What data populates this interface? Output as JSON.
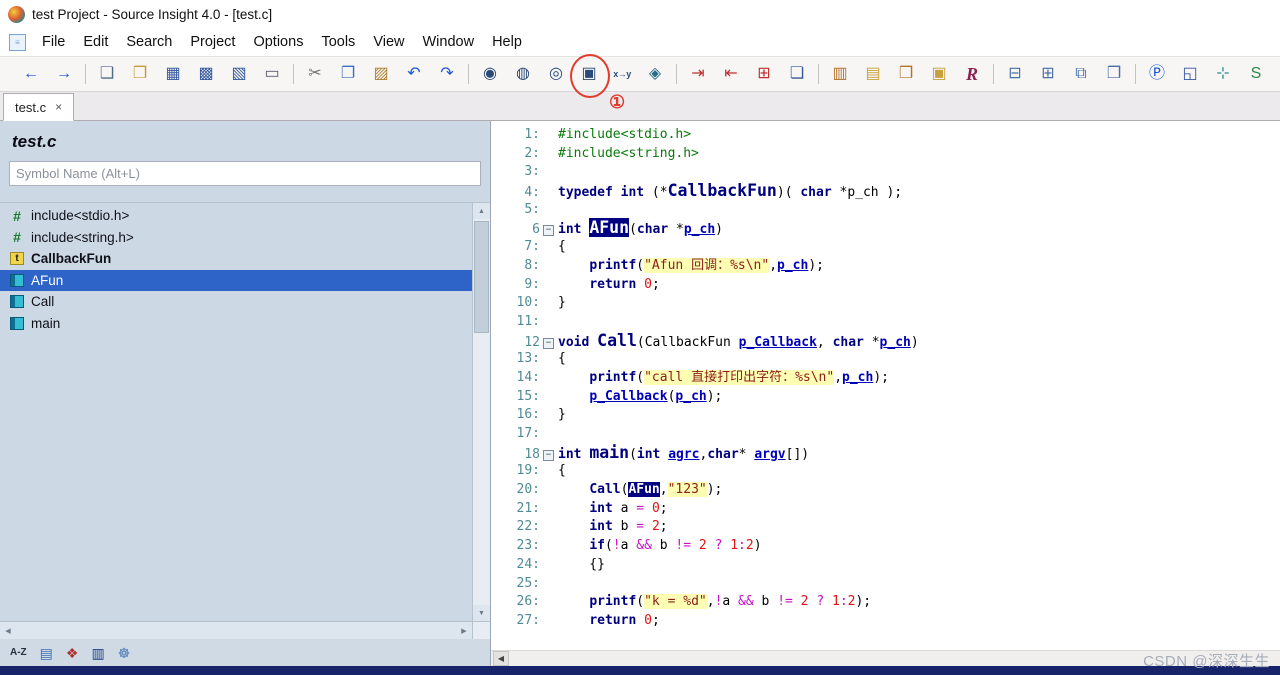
{
  "window": {
    "title": "test Project - Source Insight 4.0 - [test.c]"
  },
  "menu": {
    "items": [
      "File",
      "Edit",
      "Search",
      "Project",
      "Options",
      "Tools",
      "View",
      "Window",
      "Help"
    ]
  },
  "annotation": {
    "number": "①"
  },
  "toolbar": {
    "groups": [
      [
        {
          "name": "nav-back-icon",
          "g": "←",
          "c": "#1a56d6"
        },
        {
          "name": "nav-forward-icon",
          "g": "→",
          "c": "#1a56d6"
        }
      ],
      [
        {
          "name": "new-file-icon",
          "g": "❑",
          "c": "#55688a"
        },
        {
          "name": "open-file-icon",
          "g": "❒",
          "c": "#c79c3c"
        },
        {
          "name": "save-icon",
          "g": "▦",
          "c": "#35589e"
        },
        {
          "name": "save-all-icon",
          "g": "▩",
          "c": "#35589e"
        },
        {
          "name": "save-as-icon",
          "g": "▧",
          "c": "#35589e"
        },
        {
          "name": "print-icon",
          "g": "▭",
          "c": "#5a5a6e"
        }
      ],
      [
        {
          "name": "cut-icon",
          "g": "✂",
          "c": "#707070"
        },
        {
          "name": "copy-icon",
          "g": "❐",
          "c": "#3b6fc0"
        },
        {
          "name": "paste-icon",
          "g": "▨",
          "c": "#b08030"
        },
        {
          "name": "undo-icon",
          "g": "↶",
          "c": "#1a56d6"
        },
        {
          "name": "redo-icon",
          "g": "↷",
          "c": "#1a56d6"
        }
      ],
      [
        {
          "name": "search-icon",
          "g": "◉",
          "c": "#2a4a7a"
        },
        {
          "name": "search-forward-icon",
          "g": "◍",
          "c": "#2a4a7a"
        },
        {
          "name": "search-references-icon",
          "g": "◎",
          "c": "#2a4a7a"
        },
        {
          "name": "search-files-icon",
          "g": "▣",
          "c": "#2a4a7a",
          "circled": true
        },
        {
          "name": "replace-icon",
          "g": "x→y",
          "c": "#2a4a7a",
          "small": true
        },
        {
          "name": "search-project-icon",
          "g": "◈",
          "c": "#2a6a8a"
        }
      ],
      [
        {
          "name": "jump-to-definition-icon",
          "g": "⇥",
          "c": "#c03030"
        },
        {
          "name": "jump-to-caller-icon",
          "g": "⇤",
          "c": "#c03030"
        },
        {
          "name": "toggle-bookmark-icon",
          "g": "⊞",
          "c": "#c03030"
        },
        {
          "name": "go-back-reference-icon",
          "g": "❏",
          "c": "#35589e"
        }
      ],
      [
        {
          "name": "symbol-window-icon",
          "g": "▥",
          "c": "#b5722a"
        },
        {
          "name": "project-window-icon",
          "g": "▤",
          "c": "#caa03c"
        },
        {
          "name": "relation-window-icon",
          "g": "❒",
          "c": "#b5722a"
        },
        {
          "name": "context-window-icon",
          "g": "▣",
          "c": "#caa03c"
        },
        {
          "name": "references-icon",
          "g": "R",
          "c": "#8b2252",
          "fancy": true
        }
      ],
      [
        {
          "name": "tile-horizontal-icon",
          "g": "⊟",
          "c": "#4a6fa5"
        },
        {
          "name": "tile-vertical-icon",
          "g": "⊞",
          "c": "#4a6fa5"
        },
        {
          "name": "cascade-windows-icon",
          "g": "⧉",
          "c": "#4a6fa5"
        },
        {
          "name": "full-window-icon",
          "g": "❒",
          "c": "#4a6fa5"
        }
      ],
      [
        {
          "name": "parse-source-icon",
          "g": "Ⓟ",
          "c": "#1a56d6"
        },
        {
          "name": "zoom-window-icon",
          "g": "◱",
          "c": "#35589e"
        },
        {
          "name": "expand-special-icon",
          "g": "⊹",
          "c": "#2a8a8a"
        },
        {
          "name": "style-properties-icon",
          "g": "S",
          "c": "#2a8a4a"
        },
        {
          "name": "clip-window-icon",
          "g": "❙",
          "c": "#35589e"
        }
      ]
    ]
  },
  "tabs": [
    {
      "label": "test.c",
      "close": "×"
    }
  ],
  "symbol_panel": {
    "title": "test.c",
    "search_placeholder": "Symbol Name (Alt+L)",
    "items": [
      {
        "label": "include<stdio.h>",
        "icon": "include"
      },
      {
        "label": "include<string.h>",
        "icon": "include"
      },
      {
        "label": "CallbackFun",
        "icon": "typedef",
        "bold": true
      },
      {
        "label": "AFun",
        "icon": "func",
        "selected": true
      },
      {
        "label": "Call",
        "icon": "func"
      },
      {
        "label": "main",
        "icon": "func"
      }
    ],
    "tools": [
      {
        "name": "sort-alpha-icon",
        "g": "A-Z",
        "c": "#24303c",
        "text": true
      },
      {
        "name": "list-view-icon",
        "g": "▤",
        "c": "#3a6fb0"
      },
      {
        "name": "symbol-filter-icon",
        "g": "❖",
        "c": "#b03030"
      },
      {
        "name": "book-icon",
        "g": "▥",
        "c": "#1a3a8a"
      },
      {
        "name": "gear-icon",
        "g": "☸",
        "c": "#4a7ab5"
      }
    ]
  },
  "scrollbar": {
    "up": "▲",
    "down": "▼",
    "left": "◀",
    "right": "▶"
  },
  "editor": {
    "fold_glyph": "−",
    "lines": [
      {
        "n": 1,
        "tokens": [
          {
            "t": "inc",
            "v": "#include<stdio.h>"
          }
        ]
      },
      {
        "n": 2,
        "tokens": [
          {
            "t": "inc",
            "v": "#include<string.h>"
          }
        ]
      },
      {
        "n": 3,
        "tokens": []
      },
      {
        "n": 4,
        "tokens": [
          {
            "t": "kw",
            "v": "typedef"
          },
          {
            "t": "p",
            "v": " "
          },
          {
            "t": "kw",
            "v": "int"
          },
          {
            "t": "p",
            "v": " (*"
          },
          {
            "t": "fn",
            "v": "CallbackFun"
          },
          {
            "t": "p",
            "v": ")( "
          },
          {
            "t": "kw",
            "v": "char"
          },
          {
            "t": "p",
            "v": " *p_ch );"
          }
        ]
      },
      {
        "n": 5,
        "tokens": []
      },
      {
        "n": 6,
        "fold": true,
        "tokens": [
          {
            "t": "kw",
            "v": "int"
          },
          {
            "t": "p",
            "v": " "
          },
          {
            "t": "fnsel",
            "v": "AFun"
          },
          {
            "t": "p",
            "v": "("
          },
          {
            "t": "kw",
            "v": "char"
          },
          {
            "t": "p",
            "v": " *"
          },
          {
            "t": "param",
            "v": "p_ch"
          },
          {
            "t": "p",
            "v": ")"
          }
        ]
      },
      {
        "n": 7,
        "tokens": [
          {
            "t": "p",
            "v": "{"
          }
        ]
      },
      {
        "n": 8,
        "tokens": [
          {
            "t": "p",
            "v": "    "
          },
          {
            "t": "kw",
            "v": "printf"
          },
          {
            "t": "p",
            "v": "("
          },
          {
            "t": "str",
            "v": "\"Afun 回调：%s\\n\""
          },
          {
            "t": "p",
            "v": ","
          },
          {
            "t": "param",
            "v": "p_ch"
          },
          {
            "t": "p",
            "v": ");"
          }
        ]
      },
      {
        "n": 9,
        "tokens": [
          {
            "t": "p",
            "v": "    "
          },
          {
            "t": "kw",
            "v": "return"
          },
          {
            "t": "p",
            "v": " "
          },
          {
            "t": "num",
            "v": "0"
          },
          {
            "t": "p",
            "v": ";"
          }
        ]
      },
      {
        "n": 10,
        "tokens": [
          {
            "t": "p",
            "v": "}"
          }
        ]
      },
      {
        "n": 11,
        "tokens": []
      },
      {
        "n": 12,
        "fold": true,
        "tokens": [
          {
            "t": "kw",
            "v": "void"
          },
          {
            "t": "p",
            "v": " "
          },
          {
            "t": "fn",
            "v": "Call"
          },
          {
            "t": "p",
            "v": "(CallbackFun "
          },
          {
            "t": "param",
            "v": "p_Callback"
          },
          {
            "t": "p",
            "v": ", "
          },
          {
            "t": "kw",
            "v": "char"
          },
          {
            "t": "p",
            "v": " *"
          },
          {
            "t": "param",
            "v": "p_ch"
          },
          {
            "t": "p",
            "v": ")"
          }
        ]
      },
      {
        "n": 13,
        "tokens": [
          {
            "t": "p",
            "v": "{"
          }
        ]
      },
      {
        "n": 14,
        "tokens": [
          {
            "t": "p",
            "v": "    "
          },
          {
            "t": "kw",
            "v": "printf"
          },
          {
            "t": "p",
            "v": "("
          },
          {
            "t": "str",
            "v": "\"call 直接打印出字符：%s\\n\""
          },
          {
            "t": "p",
            "v": ","
          },
          {
            "t": "param",
            "v": "p_ch"
          },
          {
            "t": "p",
            "v": ");"
          }
        ]
      },
      {
        "n": 15,
        "tokens": [
          {
            "t": "p",
            "v": "    "
          },
          {
            "t": "param",
            "v": "p_Callback"
          },
          {
            "t": "p",
            "v": "("
          },
          {
            "t": "param",
            "v": "p_ch"
          },
          {
            "t": "p",
            "v": ");"
          }
        ]
      },
      {
        "n": 16,
        "tokens": [
          {
            "t": "p",
            "v": "}"
          }
        ]
      },
      {
        "n": 17,
        "tokens": []
      },
      {
        "n": 18,
        "fold": true,
        "tokens": [
          {
            "t": "kw",
            "v": "int"
          },
          {
            "t": "p",
            "v": " "
          },
          {
            "t": "fn",
            "v": "main"
          },
          {
            "t": "p",
            "v": "("
          },
          {
            "t": "kw",
            "v": "int"
          },
          {
            "t": "p",
            "v": " "
          },
          {
            "t": "param",
            "v": "agrc"
          },
          {
            "t": "p",
            "v": ","
          },
          {
            "t": "kw",
            "v": "char"
          },
          {
            "t": "p",
            "v": "* "
          },
          {
            "t": "param",
            "v": "argv"
          },
          {
            "t": "p",
            "v": "[])"
          }
        ]
      },
      {
        "n": 19,
        "tokens": [
          {
            "t": "p",
            "v": "{"
          }
        ]
      },
      {
        "n": 20,
        "tokens": [
          {
            "t": "p",
            "v": "    "
          },
          {
            "t": "kw",
            "v": "Call"
          },
          {
            "t": "p",
            "v": "("
          },
          {
            "t": "sel",
            "v": "AFun"
          },
          {
            "t": "p",
            "v": ","
          },
          {
            "t": "str",
            "v": "\"123\""
          },
          {
            "t": "p",
            "v": ");"
          }
        ]
      },
      {
        "n": 21,
        "tokens": [
          {
            "t": "p",
            "v": "    "
          },
          {
            "t": "kw",
            "v": "int"
          },
          {
            "t": "p",
            "v": " a "
          },
          {
            "t": "op",
            "v": "="
          },
          {
            "t": "p",
            "v": " "
          },
          {
            "t": "num",
            "v": "0"
          },
          {
            "t": "p",
            "v": ";"
          }
        ]
      },
      {
        "n": 22,
        "tokens": [
          {
            "t": "p",
            "v": "    "
          },
          {
            "t": "kw",
            "v": "int"
          },
          {
            "t": "p",
            "v": " b "
          },
          {
            "t": "op",
            "v": "="
          },
          {
            "t": "p",
            "v": " "
          },
          {
            "t": "num",
            "v": "2"
          },
          {
            "t": "p",
            "v": ";"
          }
        ]
      },
      {
        "n": 23,
        "tokens": [
          {
            "t": "p",
            "v": "    "
          },
          {
            "t": "kw",
            "v": "if"
          },
          {
            "t": "p",
            "v": "("
          },
          {
            "t": "op",
            "v": "!"
          },
          {
            "t": "p",
            "v": "a "
          },
          {
            "t": "op",
            "v": "&&"
          },
          {
            "t": "p",
            "v": " b "
          },
          {
            "t": "op",
            "v": "!="
          },
          {
            "t": "p",
            "v": " "
          },
          {
            "t": "num",
            "v": "2"
          },
          {
            "t": "p",
            "v": " "
          },
          {
            "t": "op",
            "v": "?"
          },
          {
            "t": "p",
            "v": " "
          },
          {
            "t": "num",
            "v": "1"
          },
          {
            "t": "op",
            "v": ":"
          },
          {
            "t": "num",
            "v": "2"
          },
          {
            "t": "p",
            "v": ")"
          }
        ]
      },
      {
        "n": 24,
        "tokens": [
          {
            "t": "p",
            "v": "    {}"
          }
        ]
      },
      {
        "n": 25,
        "tokens": []
      },
      {
        "n": 26,
        "tokens": [
          {
            "t": "p",
            "v": "    "
          },
          {
            "t": "kw",
            "v": "printf"
          },
          {
            "t": "p",
            "v": "("
          },
          {
            "t": "str",
            "v": "\"k = %d\""
          },
          {
            "t": "p",
            "v": ","
          },
          {
            "t": "op",
            "v": "!"
          },
          {
            "t": "p",
            "v": "a "
          },
          {
            "t": "op",
            "v": "&&"
          },
          {
            "t": "p",
            "v": " b "
          },
          {
            "t": "op",
            "v": "!="
          },
          {
            "t": "p",
            "v": " "
          },
          {
            "t": "num",
            "v": "2"
          },
          {
            "t": "p",
            "v": " "
          },
          {
            "t": "op",
            "v": "?"
          },
          {
            "t": "p",
            "v": " "
          },
          {
            "t": "num",
            "v": "1"
          },
          {
            "t": "op",
            "v": ":"
          },
          {
            "t": "num",
            "v": "2"
          },
          {
            "t": "p",
            "v": ");"
          }
        ]
      },
      {
        "n": 27,
        "tokens": [
          {
            "t": "p",
            "v": "    "
          },
          {
            "t": "kw",
            "v": "return"
          },
          {
            "t": "p",
            "v": " "
          },
          {
            "t": "num",
            "v": "0"
          },
          {
            "t": "p",
            "v": ";"
          }
        ]
      }
    ]
  },
  "watermark": "CSDN @深深生生",
  "colors": {
    "selection": "#000080",
    "string_bg": "#ffffb4",
    "keyword": "#00007e",
    "annotation_red": "#e23b2e",
    "panel_bg": "#ccd8e4",
    "statusbar": "#18246a"
  }
}
